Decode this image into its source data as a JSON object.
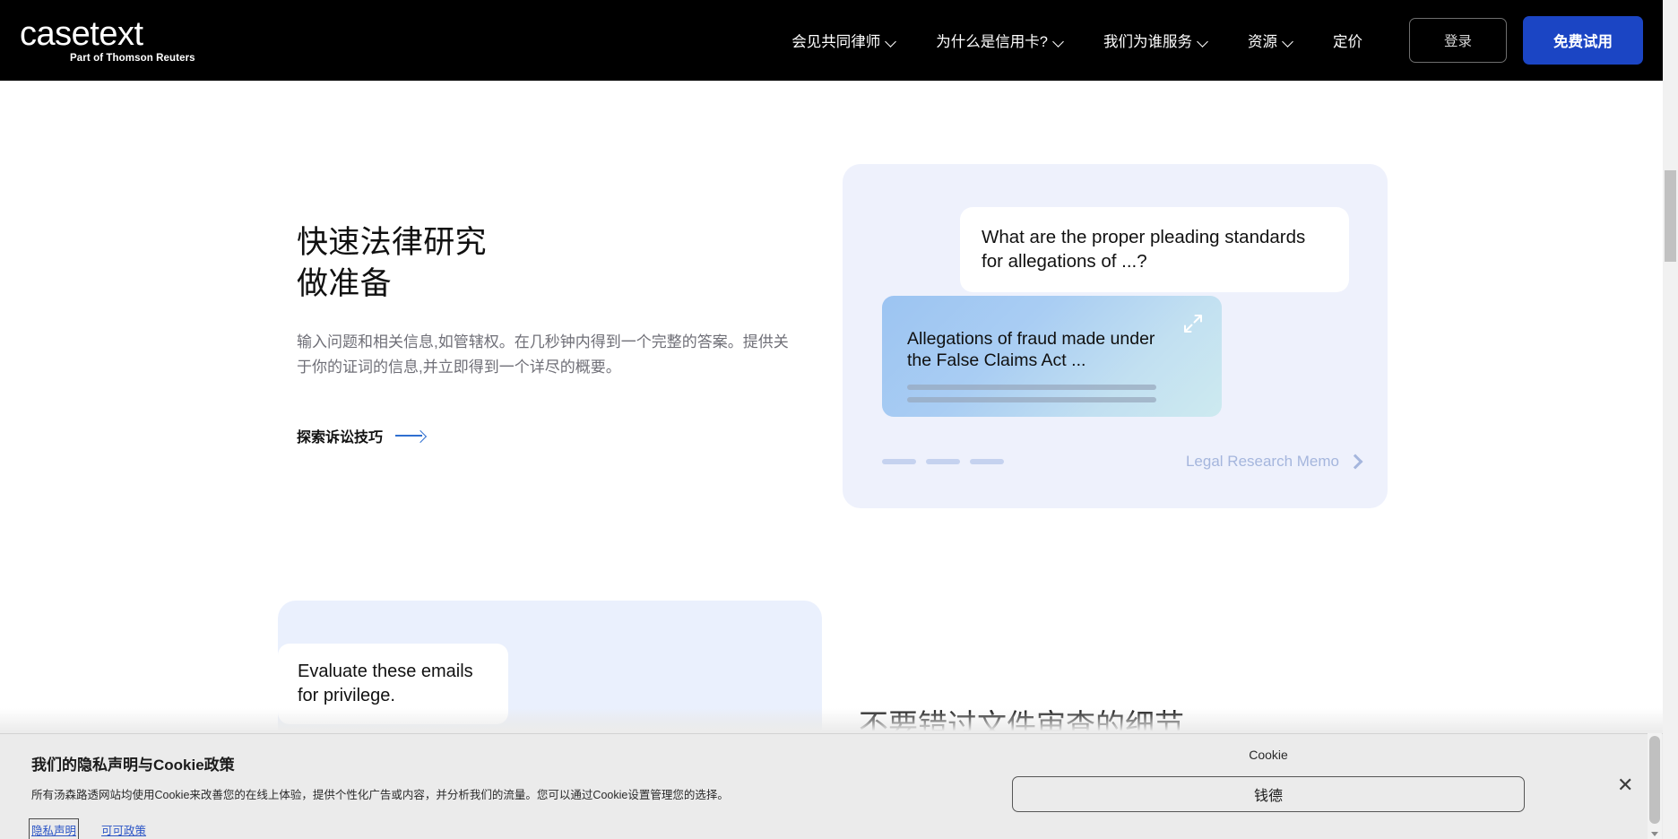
{
  "navbar": {
    "logo": {
      "word": "casetext",
      "subtitle": "Part of Thomson Reuters"
    },
    "links": [
      {
        "label": "会见共同律师",
        "has_caret": true
      },
      {
        "label": "为什么是信用卡?",
        "has_caret": true
      },
      {
        "label": "我们为谁服务",
        "has_caret": true
      },
      {
        "label": "资源",
        "has_caret": true
      },
      {
        "label": "定价",
        "has_caret": false
      }
    ],
    "login_label": "登录",
    "trial_label": "免费试用",
    "background_color": "#000000",
    "trial_color": "#1b45c4"
  },
  "hero": {
    "title_line1": "快速法律研究",
    "title_line2": "做准备",
    "description": "输入问题和相关信息,如管辖权。在几秒钟内得到一个完整的答案。提供关于你的证词的信息,并立即得到一个详尽的概要。",
    "link_label": "探索诉讼技巧",
    "arrow_color": "#2f6fd0"
  },
  "hero_panel": {
    "background_color": "#eef1fc",
    "question": "What are the proper pleading standards for allegations of ...?",
    "answer": "Allegations of fraud made under the False Claims Act ...",
    "expand_icon": "expand-arrows-icon",
    "gradient_start": "#9cc4f2",
    "gradient_end": "#cdeaf0",
    "dots_count": 3,
    "memo_label": "Legal Research Memo",
    "memo_color": "#a5b6dd"
  },
  "section_two": {
    "bubble_text": "Evaluate these emails for privilege.",
    "heading": "不要错过文件审查的细节",
    "panel_color": "#eaf0fd"
  },
  "cookie_banner": {
    "title": "我们的隐私声明与Cookie政策",
    "body": "所有汤森路透网站均使用Cookie来改善您的在线上体验，提供个性化广告或内容，并分析我们的流量。您可以通过Cookie设置管理您的选择。",
    "links": [
      {
        "label": "隐私声明",
        "focused": true
      },
      {
        "label": "可可政策",
        "focused": false
      }
    ],
    "right_label": "Cookie",
    "accept_label": "钱德",
    "close_label": "✕",
    "background_color": "#ebebeb",
    "link_color": "#2b55c6"
  }
}
